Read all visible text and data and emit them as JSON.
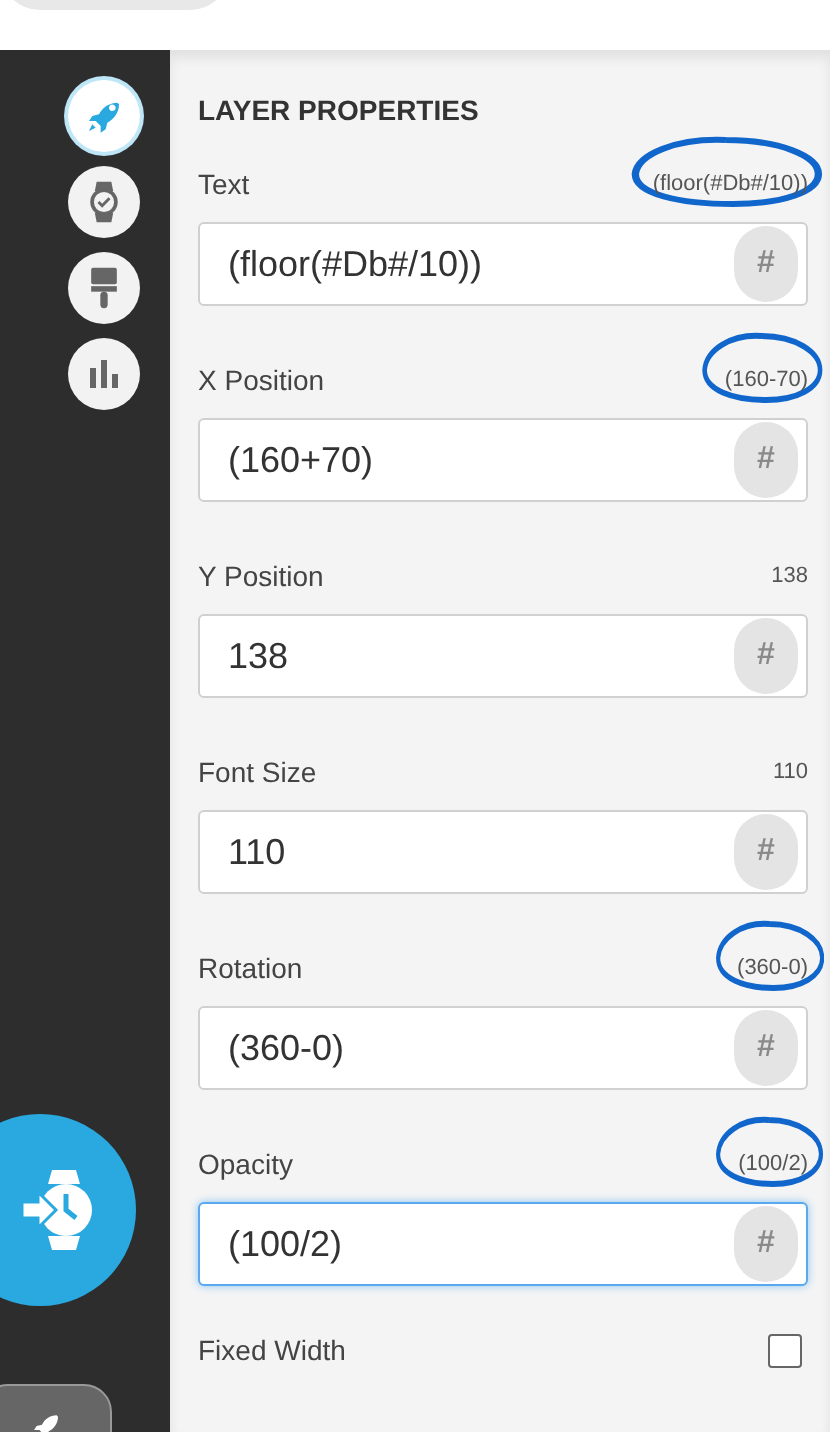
{
  "sidebar": {
    "items": [
      {
        "kind": "rocket",
        "selected": true
      },
      {
        "kind": "watch",
        "selected": false
      },
      {
        "kind": "brush",
        "selected": false
      },
      {
        "kind": "chart",
        "selected": false
      }
    ]
  },
  "panel": {
    "title": "LAYER PROPERTIES",
    "fields": [
      {
        "label": "Text",
        "reading": "(floor(#Db#/10))",
        "value": "(floor(#Db#/10))",
        "button": "#",
        "circled": true,
        "focused": false
      },
      {
        "label": "X Position",
        "reading": "(160-70)",
        "value": "(160+70)",
        "button": "#",
        "circled": true,
        "focused": false
      },
      {
        "label": "Y Position",
        "reading": "138",
        "value": "138",
        "button": "#",
        "circled": false,
        "focused": false
      },
      {
        "label": "Font Size",
        "reading": "110",
        "value": "110",
        "button": "#",
        "circled": false,
        "focused": false
      },
      {
        "label": "Rotation",
        "reading": "(360-0)",
        "value": "(360-0)",
        "button": "#",
        "circled": true,
        "focused": false
      },
      {
        "label": "Opacity",
        "reading": "(100/2)",
        "value": "(100/2)",
        "button": "#",
        "circled": true,
        "focused": true
      }
    ],
    "checkbox": {
      "label": "Fixed Width",
      "checked": false
    }
  }
}
